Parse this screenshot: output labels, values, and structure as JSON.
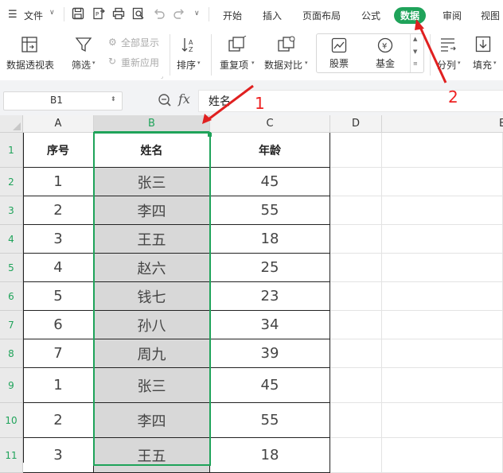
{
  "menu": {
    "hamburger_label": "文件",
    "tabs": [
      "开始",
      "插入",
      "页面布局",
      "公式",
      "数据",
      "审阅",
      "视图"
    ],
    "active_tab": "数据"
  },
  "ribbon": {
    "pivot": "数据透视表",
    "filter": "筛选",
    "show_all": "全部显示",
    "reapply": "重新应用",
    "sort": "排序",
    "duplicates": "重复项",
    "compare": "数据对比",
    "stock": "股票",
    "fund": "基金",
    "split": "分列",
    "fill": "填充"
  },
  "formula_bar": {
    "cell_ref": "B1",
    "fx_label": "fx",
    "content": "姓名"
  },
  "columns": [
    "A",
    "B",
    "C",
    "D",
    "E"
  ],
  "rows": [
    "1",
    "2",
    "3",
    "4",
    "5",
    "6",
    "7",
    "8",
    "9",
    "10",
    "11"
  ],
  "table": {
    "headers": [
      "序号",
      "姓名",
      "年龄"
    ],
    "data": [
      [
        "1",
        "张三",
        "45"
      ],
      [
        "2",
        "李四",
        "55"
      ],
      [
        "3",
        "王五",
        "18"
      ],
      [
        "4",
        "赵六",
        "25"
      ],
      [
        "5",
        "钱七",
        "23"
      ],
      [
        "6",
        "孙八",
        "34"
      ],
      [
        "7",
        "周九",
        "39"
      ],
      [
        "1",
        "张三",
        "45"
      ],
      [
        "2",
        "李四",
        "55"
      ],
      [
        "3",
        "王五",
        "18"
      ]
    ]
  },
  "annotations": {
    "arrow1": "1",
    "arrow2": "2",
    "color": "#e02020"
  },
  "colors": {
    "accent": "#1fa35a",
    "selection": "#d8d8d8"
  }
}
